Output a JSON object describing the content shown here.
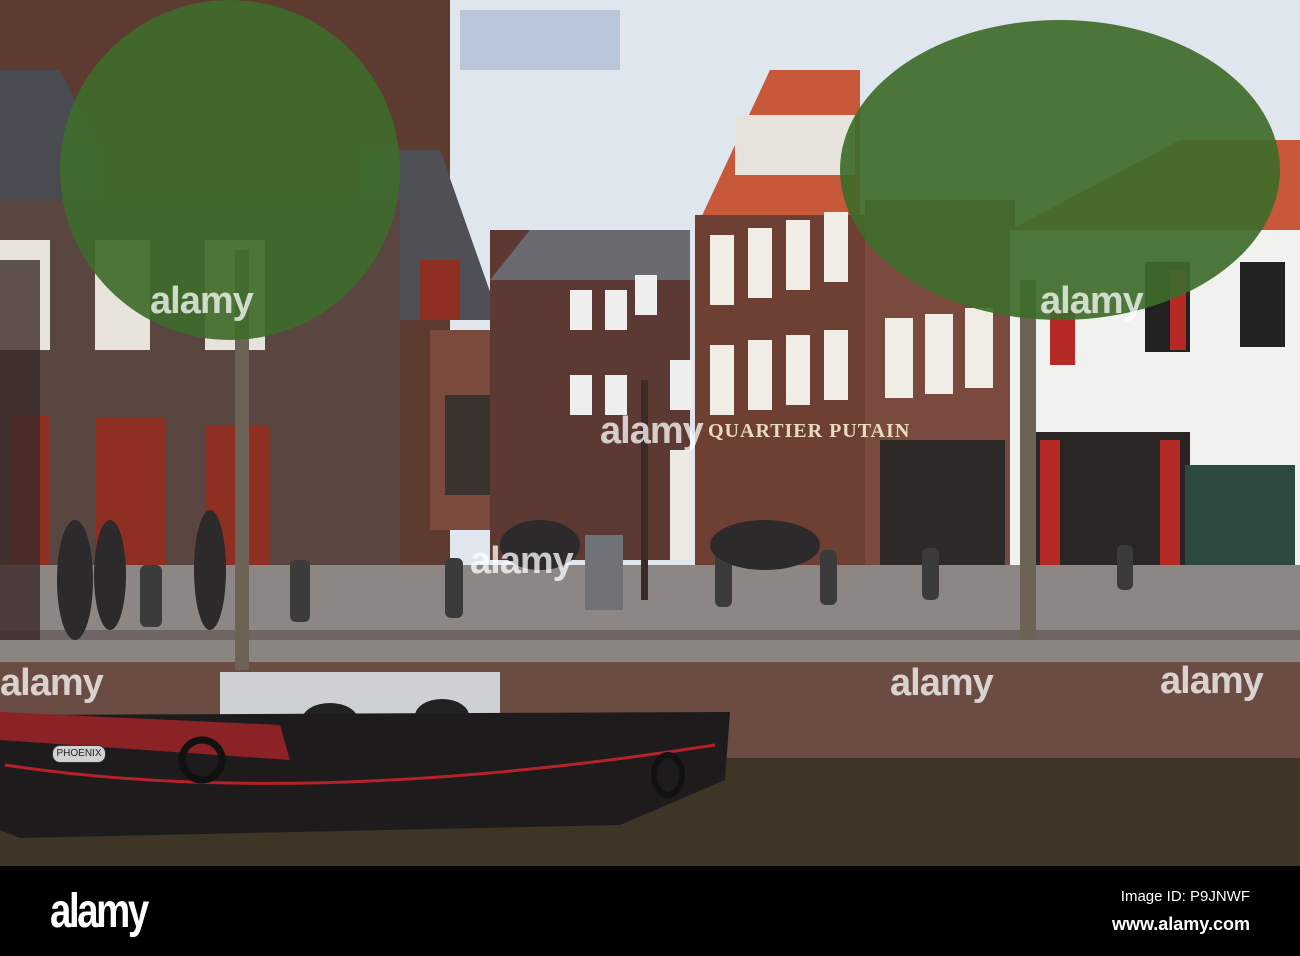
{
  "photo": {
    "storefront_sign": "QUARTIER PUTAIN",
    "boat_name": "PHOENIX",
    "watermarks": [
      "alamy",
      "alamy",
      "alamy",
      "alamy",
      "alamy",
      "alamy",
      "alamy"
    ]
  },
  "footer": {
    "logo": "alamy",
    "image_id": "Image ID: P9JNWF",
    "url": "www.alamy.com"
  },
  "colors": {
    "sky": "#dfe6ee",
    "brick": "#6e3f33",
    "roof": "#c8583a",
    "water": "#3f3526",
    "tree": "#3f6b2a"
  }
}
